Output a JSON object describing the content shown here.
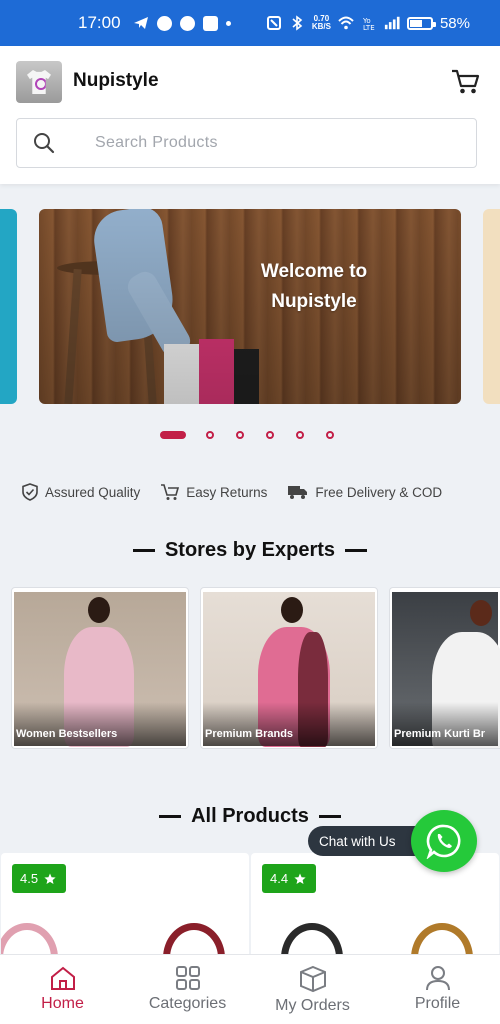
{
  "status_bar": {
    "time": "17:00",
    "net_speed_value": "0.70",
    "net_speed_unit": "KB/S",
    "battery": "58%"
  },
  "header": {
    "app_name": "Nupistyle",
    "search_placeholder": "Search Products"
  },
  "banner": {
    "headline_line1": "Welcome to",
    "headline_line2": "Nupistyle",
    "slide_count": 6,
    "active_slide": 1
  },
  "features": [
    {
      "label": "Assured Quality",
      "icon": "shield-check-icon"
    },
    {
      "label": "Easy Returns",
      "icon": "cart-return-icon"
    },
    {
      "label": "Free Delivery & COD",
      "icon": "truck-icon"
    }
  ],
  "stores_section": {
    "title": "Stores by Experts",
    "stores": [
      {
        "label": "Women Bestsellers"
      },
      {
        "label": "Premium Brands"
      },
      {
        "label": "Premium Kurti Br"
      }
    ]
  },
  "products_section": {
    "title": "All Products",
    "products": [
      {
        "rating": "4.5"
      },
      {
        "rating": "4.4"
      }
    ]
  },
  "chat": {
    "label": "Chat with Us"
  },
  "bottom_nav": [
    {
      "label": "Home",
      "icon": "home-icon",
      "active": true
    },
    {
      "label": "Categories",
      "icon": "categories-grid-icon",
      "active": false
    },
    {
      "label": "My Orders",
      "icon": "box-icon",
      "active": false
    },
    {
      "label": "Profile",
      "icon": "user-icon",
      "active": false
    }
  ],
  "colors": {
    "status_bar": "#1e6bd6",
    "accent": "#c21f47",
    "rating_badge": "#1ea41a",
    "whatsapp": "#25c93a",
    "background": "#eef1f5"
  }
}
